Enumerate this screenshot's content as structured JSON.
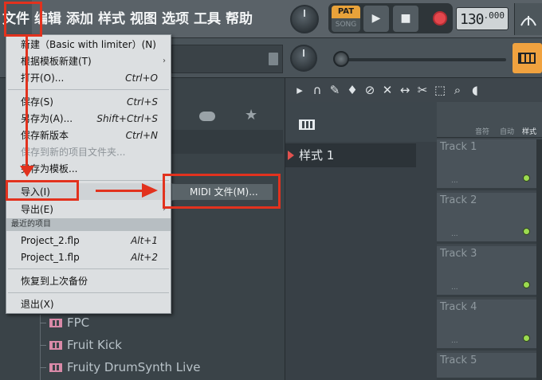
{
  "menubar": {
    "items": [
      "文件",
      "编辑",
      "添加",
      "样式",
      "视图",
      "选项",
      "工具",
      "帮助"
    ]
  },
  "transport": {
    "pat_label": "PAT",
    "song_label": "SONG",
    "tempo_main": "130",
    "tempo_decimal": ".000"
  },
  "file_menu": {
    "items": [
      {
        "label": "新建（Basic with limiter）(N)",
        "shortcut": ""
      },
      {
        "label": "根据模板新建(T)",
        "shortcut": ""
      },
      {
        "label": "打开(O)...",
        "shortcut": "Ctrl+O"
      },
      {
        "label": "保存(S)",
        "shortcut": "Ctrl+S"
      },
      {
        "label": "另存为(A)...",
        "shortcut": "Shift+Ctrl+S"
      },
      {
        "label": "保存新版本",
        "shortcut": "Ctrl+N"
      },
      {
        "label": "保存到新的项目文件夹...",
        "shortcut": ""
      },
      {
        "label": "另存为模板...",
        "shortcut": ""
      },
      {
        "label": "导入(I)",
        "shortcut": ""
      },
      {
        "label": "导出(E)",
        "shortcut": ""
      },
      {
        "label": "Project_2.flp",
        "shortcut": "Alt+1"
      },
      {
        "label": "Project_1.flp",
        "shortcut": "Alt+2"
      },
      {
        "label": "恢复到上次备份",
        "shortcut": ""
      },
      {
        "label": "退出(X)",
        "shortcut": ""
      }
    ],
    "recent_header": "最近的项目"
  },
  "import_submenu": {
    "midi_label": "MIDI 文件(M)..."
  },
  "browser": {
    "items": [
      "FPC",
      "Fruit Kick",
      "Fruity DrumSynth Live"
    ]
  },
  "channel_rack": {
    "pattern_label": "样式 1",
    "head_labels": [
      "音符",
      "自动",
      "样式"
    ]
  },
  "playlist": {
    "tracks": [
      "Track 1",
      "Track 2",
      "Track 3",
      "Track 4",
      "Track 5"
    ],
    "dots": "..."
  },
  "colors": {
    "annotation": "#e2321e",
    "accent": "#f0a23f",
    "led": "#9cdb50"
  }
}
